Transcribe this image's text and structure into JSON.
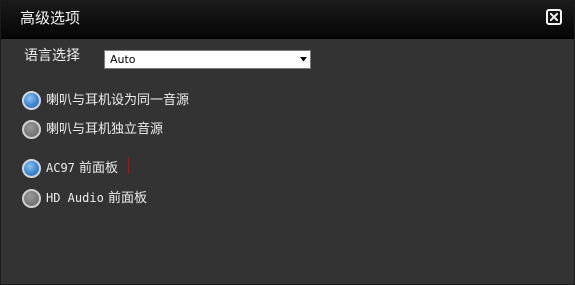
{
  "window": {
    "title": "高级选项",
    "close_icon": "close-icon"
  },
  "language": {
    "label": "语言选择",
    "selected_value": "Auto"
  },
  "speaker_mode": {
    "options": [
      {
        "label": "喇叭与耳机设为同一音源",
        "selected": true
      },
      {
        "label": "喇叭与耳机独立音源",
        "selected": false
      }
    ]
  },
  "front_panel": {
    "options": [
      {
        "code": "AC97",
        "suffix": "前面板",
        "selected": true
      },
      {
        "code": "HD Audio",
        "suffix": "前面板",
        "selected": false
      }
    ]
  },
  "colors": {
    "background": "#333333",
    "titlebar": "#0a0a0a",
    "radio_selected": "#3f86cf",
    "radio_unselected": "#787878"
  }
}
